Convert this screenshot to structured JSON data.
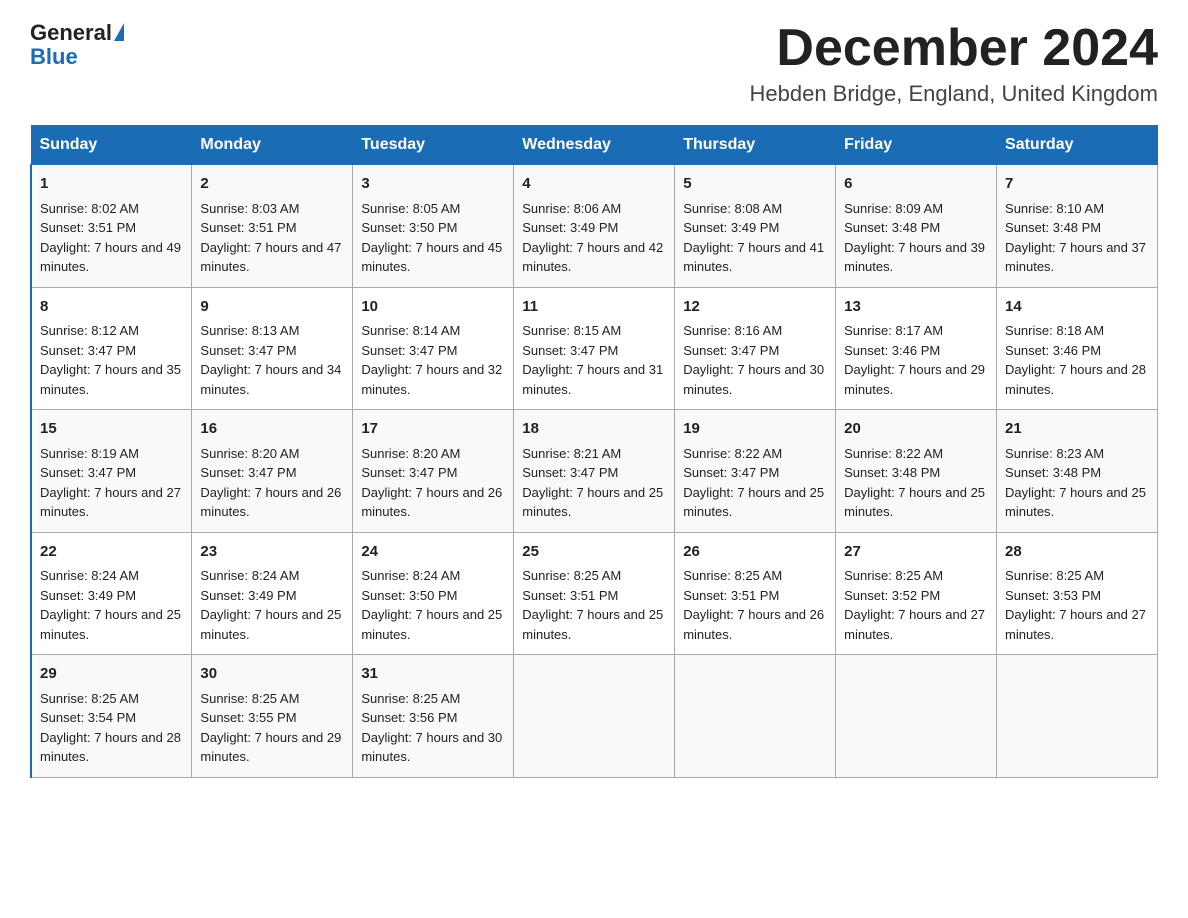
{
  "header": {
    "logo_general": "General",
    "logo_blue": "Blue",
    "month_title": "December 2024",
    "location": "Hebden Bridge, England, United Kingdom"
  },
  "days_of_week": [
    "Sunday",
    "Monday",
    "Tuesday",
    "Wednesday",
    "Thursday",
    "Friday",
    "Saturday"
  ],
  "weeks": [
    [
      {
        "day": "1",
        "sunrise": "Sunrise: 8:02 AM",
        "sunset": "Sunset: 3:51 PM",
        "daylight": "Daylight: 7 hours and 49 minutes."
      },
      {
        "day": "2",
        "sunrise": "Sunrise: 8:03 AM",
        "sunset": "Sunset: 3:51 PM",
        "daylight": "Daylight: 7 hours and 47 minutes."
      },
      {
        "day": "3",
        "sunrise": "Sunrise: 8:05 AM",
        "sunset": "Sunset: 3:50 PM",
        "daylight": "Daylight: 7 hours and 45 minutes."
      },
      {
        "day": "4",
        "sunrise": "Sunrise: 8:06 AM",
        "sunset": "Sunset: 3:49 PM",
        "daylight": "Daylight: 7 hours and 42 minutes."
      },
      {
        "day": "5",
        "sunrise": "Sunrise: 8:08 AM",
        "sunset": "Sunset: 3:49 PM",
        "daylight": "Daylight: 7 hours and 41 minutes."
      },
      {
        "day": "6",
        "sunrise": "Sunrise: 8:09 AM",
        "sunset": "Sunset: 3:48 PM",
        "daylight": "Daylight: 7 hours and 39 minutes."
      },
      {
        "day": "7",
        "sunrise": "Sunrise: 8:10 AM",
        "sunset": "Sunset: 3:48 PM",
        "daylight": "Daylight: 7 hours and 37 minutes."
      }
    ],
    [
      {
        "day": "8",
        "sunrise": "Sunrise: 8:12 AM",
        "sunset": "Sunset: 3:47 PM",
        "daylight": "Daylight: 7 hours and 35 minutes."
      },
      {
        "day": "9",
        "sunrise": "Sunrise: 8:13 AM",
        "sunset": "Sunset: 3:47 PM",
        "daylight": "Daylight: 7 hours and 34 minutes."
      },
      {
        "day": "10",
        "sunrise": "Sunrise: 8:14 AM",
        "sunset": "Sunset: 3:47 PM",
        "daylight": "Daylight: 7 hours and 32 minutes."
      },
      {
        "day": "11",
        "sunrise": "Sunrise: 8:15 AM",
        "sunset": "Sunset: 3:47 PM",
        "daylight": "Daylight: 7 hours and 31 minutes."
      },
      {
        "day": "12",
        "sunrise": "Sunrise: 8:16 AM",
        "sunset": "Sunset: 3:47 PM",
        "daylight": "Daylight: 7 hours and 30 minutes."
      },
      {
        "day": "13",
        "sunrise": "Sunrise: 8:17 AM",
        "sunset": "Sunset: 3:46 PM",
        "daylight": "Daylight: 7 hours and 29 minutes."
      },
      {
        "day": "14",
        "sunrise": "Sunrise: 8:18 AM",
        "sunset": "Sunset: 3:46 PM",
        "daylight": "Daylight: 7 hours and 28 minutes."
      }
    ],
    [
      {
        "day": "15",
        "sunrise": "Sunrise: 8:19 AM",
        "sunset": "Sunset: 3:47 PM",
        "daylight": "Daylight: 7 hours and 27 minutes."
      },
      {
        "day": "16",
        "sunrise": "Sunrise: 8:20 AM",
        "sunset": "Sunset: 3:47 PM",
        "daylight": "Daylight: 7 hours and 26 minutes."
      },
      {
        "day": "17",
        "sunrise": "Sunrise: 8:20 AM",
        "sunset": "Sunset: 3:47 PM",
        "daylight": "Daylight: 7 hours and 26 minutes."
      },
      {
        "day": "18",
        "sunrise": "Sunrise: 8:21 AM",
        "sunset": "Sunset: 3:47 PM",
        "daylight": "Daylight: 7 hours and 25 minutes."
      },
      {
        "day": "19",
        "sunrise": "Sunrise: 8:22 AM",
        "sunset": "Sunset: 3:47 PM",
        "daylight": "Daylight: 7 hours and 25 minutes."
      },
      {
        "day": "20",
        "sunrise": "Sunrise: 8:22 AM",
        "sunset": "Sunset: 3:48 PM",
        "daylight": "Daylight: 7 hours and 25 minutes."
      },
      {
        "day": "21",
        "sunrise": "Sunrise: 8:23 AM",
        "sunset": "Sunset: 3:48 PM",
        "daylight": "Daylight: 7 hours and 25 minutes."
      }
    ],
    [
      {
        "day": "22",
        "sunrise": "Sunrise: 8:24 AM",
        "sunset": "Sunset: 3:49 PM",
        "daylight": "Daylight: 7 hours and 25 minutes."
      },
      {
        "day": "23",
        "sunrise": "Sunrise: 8:24 AM",
        "sunset": "Sunset: 3:49 PM",
        "daylight": "Daylight: 7 hours and 25 minutes."
      },
      {
        "day": "24",
        "sunrise": "Sunrise: 8:24 AM",
        "sunset": "Sunset: 3:50 PM",
        "daylight": "Daylight: 7 hours and 25 minutes."
      },
      {
        "day": "25",
        "sunrise": "Sunrise: 8:25 AM",
        "sunset": "Sunset: 3:51 PM",
        "daylight": "Daylight: 7 hours and 25 minutes."
      },
      {
        "day": "26",
        "sunrise": "Sunrise: 8:25 AM",
        "sunset": "Sunset: 3:51 PM",
        "daylight": "Daylight: 7 hours and 26 minutes."
      },
      {
        "day": "27",
        "sunrise": "Sunrise: 8:25 AM",
        "sunset": "Sunset: 3:52 PM",
        "daylight": "Daylight: 7 hours and 27 minutes."
      },
      {
        "day": "28",
        "sunrise": "Sunrise: 8:25 AM",
        "sunset": "Sunset: 3:53 PM",
        "daylight": "Daylight: 7 hours and 27 minutes."
      }
    ],
    [
      {
        "day": "29",
        "sunrise": "Sunrise: 8:25 AM",
        "sunset": "Sunset: 3:54 PM",
        "daylight": "Daylight: 7 hours and 28 minutes."
      },
      {
        "day": "30",
        "sunrise": "Sunrise: 8:25 AM",
        "sunset": "Sunset: 3:55 PM",
        "daylight": "Daylight: 7 hours and 29 minutes."
      },
      {
        "day": "31",
        "sunrise": "Sunrise: 8:25 AM",
        "sunset": "Sunset: 3:56 PM",
        "daylight": "Daylight: 7 hours and 30 minutes."
      },
      null,
      null,
      null,
      null
    ]
  ]
}
